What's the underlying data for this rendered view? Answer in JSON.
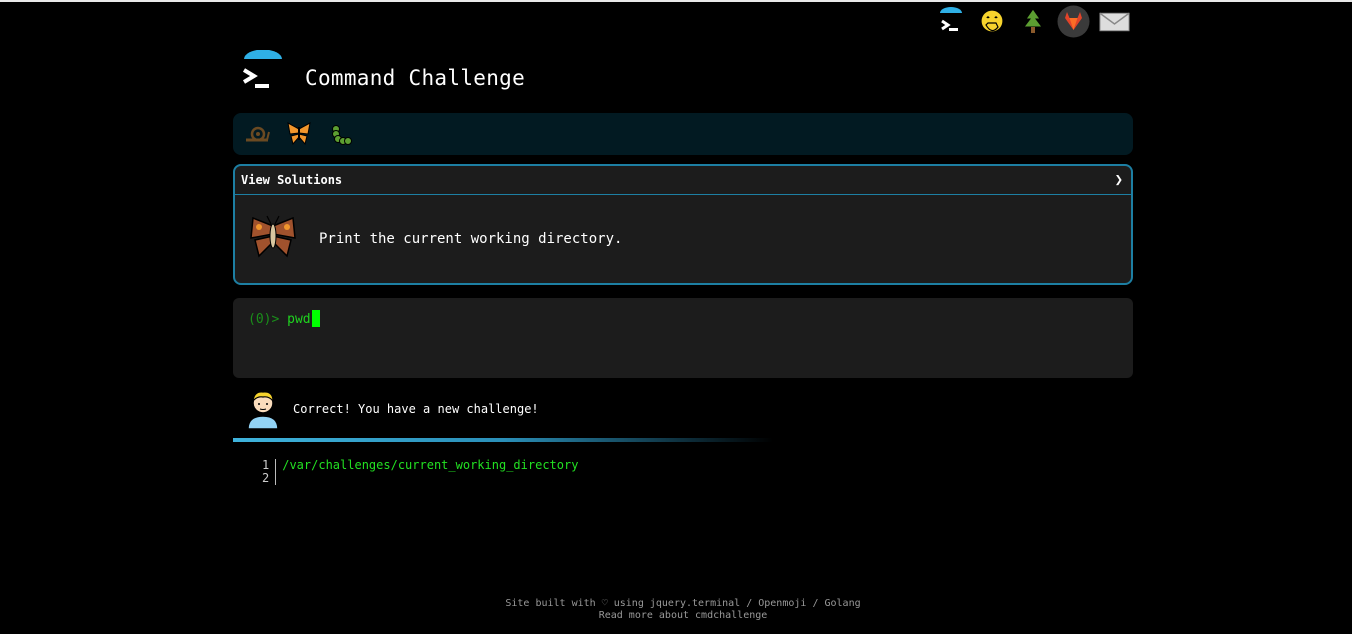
{
  "app": {
    "title": "Command Challenge"
  },
  "topnav": {
    "items": [
      {
        "icon": "terminal-logo-icon"
      },
      {
        "icon": "face-hand-over-mouth-icon"
      },
      {
        "icon": "evergreen-tree-icon"
      },
      {
        "icon": "gitlab-icon"
      },
      {
        "icon": "envelope-icon"
      }
    ]
  },
  "progress": {
    "items": [
      {
        "icon": "snail-icon"
      },
      {
        "icon": "butterfly-icon"
      },
      {
        "icon": "caterpillar-icon"
      }
    ]
  },
  "challenge": {
    "solutions_label": "View Solutions",
    "chevron": "❯",
    "description": "Print the current working directory.",
    "icon": "moth-icon"
  },
  "terminal": {
    "prompt": "(0)> ",
    "command": "pwd"
  },
  "result": {
    "message": "Correct! You have a new challenge!",
    "avatar": "person-avatar-icon"
  },
  "output": {
    "line_numbers": [
      "1",
      "2"
    ],
    "lines": [
      "/var/challenges/current_working_directory",
      ""
    ]
  },
  "footer": {
    "line1_prefix": "Site built with ♡ using ",
    "link_jquery": "jquery.terminal",
    "sep1": " / ",
    "link_openmoji": "Openmoji",
    "sep2": " / ",
    "link_golang": "Golang",
    "line2": "Read more about cmdchallenge"
  },
  "colors": {
    "accent": "#1d7fa3",
    "terminal_green": "#1fd41f",
    "progress_bg": "#021a22"
  }
}
